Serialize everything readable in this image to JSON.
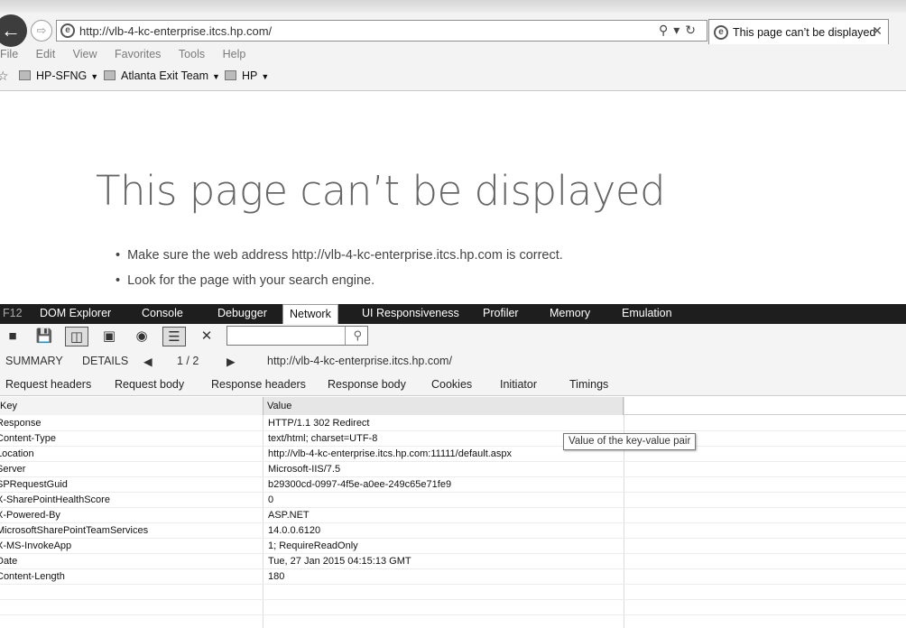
{
  "browser": {
    "url": "http://vlb-4-kc-enterprise.itcs.hp.com/",
    "tab_title": "This page can’t be displayed",
    "menu": [
      "File",
      "Edit",
      "View",
      "Favorites",
      "Tools",
      "Help"
    ],
    "favorites": [
      "HP-SFNG",
      "Atlanta Exit Team",
      "HP"
    ]
  },
  "error_page": {
    "title": "This page can’t be displayed",
    "bullets": [
      "Make sure the web address http://vlb-4-kc-enterprise.itcs.hp.com is correct.",
      "Look for the page with your search engine."
    ]
  },
  "devtools": {
    "f12": "F12",
    "tabs": [
      "DOM Explorer",
      "Console",
      "Debugger",
      "Network",
      "UI Responsiveness",
      "Profiler",
      "Memory",
      "Emulation"
    ],
    "active_tab": "Network",
    "summary": "SUMMARY",
    "details": "DETAILS",
    "page_indicator": "1 / 2",
    "request_url": "http://vlb-4-kc-enterprise.itcs.hp.com/",
    "subtabs": [
      "Request headers",
      "Request body",
      "Response headers",
      "Response body",
      "Cookies",
      "Initiator",
      "Timings"
    ],
    "table": {
      "col_key": "Key",
      "col_value": "Value",
      "rows": [
        {
          "key": "Response",
          "value": "HTTP/1.1 302 Redirect"
        },
        {
          "key": "Content-Type",
          "value": "text/html; charset=UTF-8"
        },
        {
          "key": "Location",
          "value": "http://vlb-4-kc-enterprise.itcs.hp.com:11111/default.aspx"
        },
        {
          "key": "Server",
          "value": "Microsoft-IIS/7.5"
        },
        {
          "key": "SPRequestGuid",
          "value": "b29300cd-0997-4f5e-a0ee-249c65e71fe9"
        },
        {
          "key": "X-SharePointHealthScore",
          "value": "0"
        },
        {
          "key": "X-Powered-By",
          "value": "ASP.NET"
        },
        {
          "key": "MicrosoftSharePointTeamServices",
          "value": "14.0.0.6120"
        },
        {
          "key": "X-MS-InvokeApp",
          "value": "1; RequireReadOnly"
        },
        {
          "key": "Date",
          "value": "Tue, 27 Jan 2015 04:15:13 GMT"
        },
        {
          "key": "Content-Length",
          "value": "180"
        },
        {
          "key": "",
          "value": ""
        },
        {
          "key": "",
          "value": ""
        },
        {
          "key": "",
          "value": ""
        }
      ]
    },
    "tooltip": "Value of the key-value pair"
  }
}
